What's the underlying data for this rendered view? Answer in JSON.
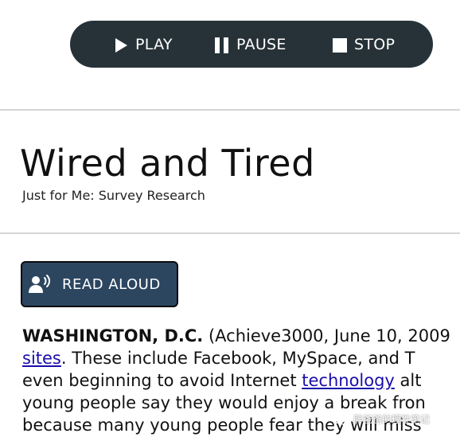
{
  "player": {
    "play_label": "PLAY",
    "pause_label": "PAUSE",
    "stop_label": "STOP"
  },
  "article": {
    "title": "Wired and Tired",
    "subtitle": "Just for Me: Survey Research",
    "read_aloud_label": "READ ALOUD",
    "lines": {
      "l1_dateline": "WASHINGTON, D.C.",
      "l1_rest": " (Achieve3000, June 10, 2009",
      "l2_link": "sites",
      "l2_rest": ". These include Facebook, MySpace, and T",
      "l3_pre": "even beginning to avoid Internet ",
      "l3_link": "technology",
      "l3_post": " alt",
      "l4": "young people say they would enjoy a break fron",
      "l5": "because many young people fear they will miss"
    }
  },
  "watermark": {
    "text": "胖爸爸的理性笔记"
  },
  "colors": {
    "player_bg": "#263238",
    "read_aloud_bg": "#2c4660",
    "link": "#1a0dab"
  }
}
